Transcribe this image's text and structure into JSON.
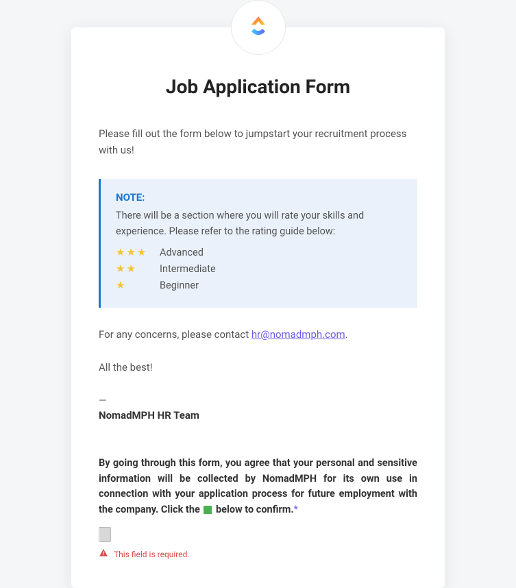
{
  "title": "Job Application Form",
  "intro": "Please fill out the form below to jumpstart your recruitment process with us!",
  "note": {
    "title": "NOTE:",
    "text": "There will be a section where you will rate your skills and experience. Please refer to the rating guide below:",
    "ratings": [
      {
        "stars": 3,
        "label": "Advanced"
      },
      {
        "stars": 2,
        "label": "Intermediate"
      },
      {
        "stars": 1,
        "label": "Beginner"
      }
    ]
  },
  "concern_prefix": "For any concerns, please contact ",
  "concern_email": "hr@nomadmph.com",
  "concern_suffix": ".",
  "best": "All the best!",
  "dash": "—",
  "signature": "NomadMPH HR Team",
  "consent_part1": "By going through this form, you agree that your personal and sensitive information will be collected by NomadMPH for its own use in connection with your application process for future employment with the company. Click the",
  "consent_part2": "below to confirm.",
  "asterisk": "*",
  "error": "This field is required."
}
